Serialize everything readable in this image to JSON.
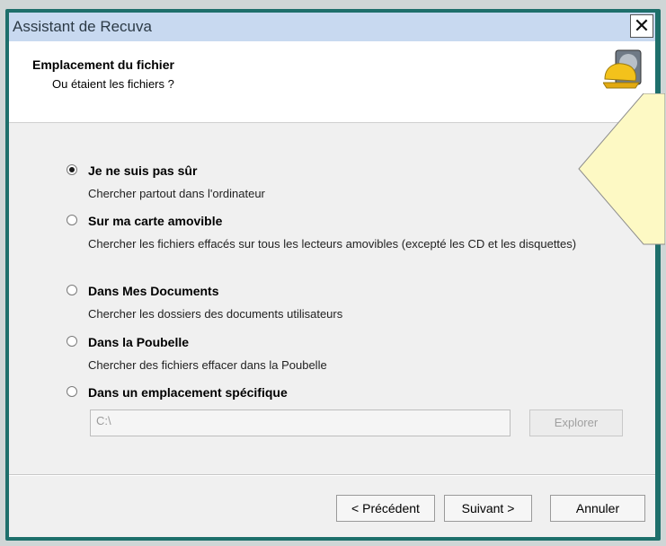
{
  "window": {
    "title": "Assistant de Recuva",
    "close_glyph": "✕"
  },
  "header": {
    "title": "Emplacement du fichier",
    "subtitle": "Ou étaient les fichiers ?"
  },
  "options": [
    {
      "label": "Je ne suis pas sûr",
      "description": "Chercher partout dans l'ordinateur",
      "selected": true
    },
    {
      "label": "Sur ma carte amovible",
      "description": "Chercher les fichiers effacés sur tous les lecteurs amovibles (excepté les CD et les disquettes)",
      "selected": false
    },
    {
      "label": "Dans Mes Documents",
      "description": "Chercher les dossiers des documents utilisateurs",
      "selected": false
    },
    {
      "label": "Dans la Poubelle",
      "description": "Chercher des fichiers effacer dans la Poubelle",
      "selected": false
    },
    {
      "label": "Dans un emplacement spécifique",
      "description": "",
      "selected": false
    }
  ],
  "location": {
    "path_value": "C:\\",
    "explore_label": "Explorer"
  },
  "buttons": {
    "back": "< Précédent",
    "next": "Suivant >",
    "cancel": "Annuler"
  },
  "colors": {
    "titlebar": "#c8d9f0",
    "frame": "#1e6f6b",
    "tooltip": "#fdf9c4"
  }
}
